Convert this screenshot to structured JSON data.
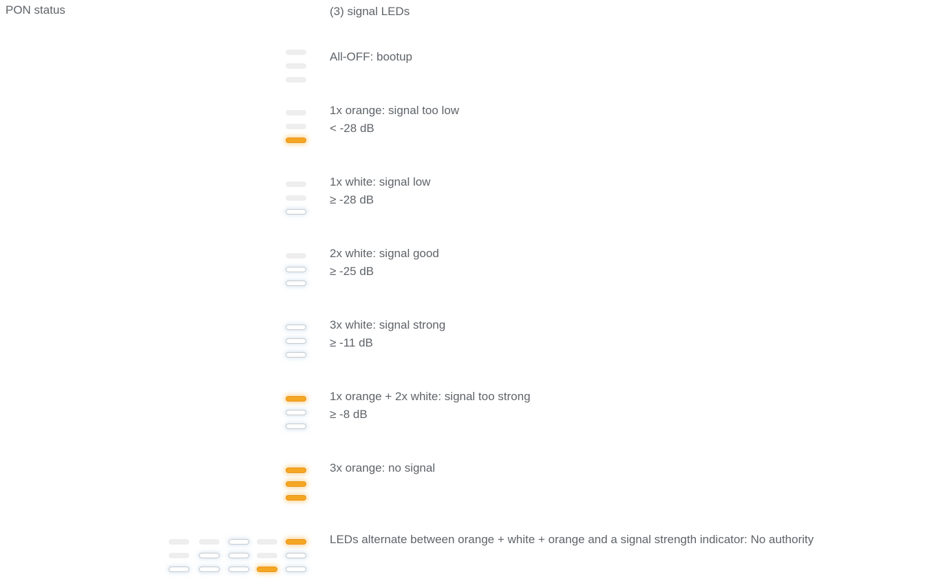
{
  "section_label": "PON status",
  "header": "(3) signal LEDs",
  "colors": {
    "off": "#eeeeee",
    "white": "#ffffff",
    "orange": "#f5a623"
  },
  "states": [
    {
      "leds": [
        "off",
        "off",
        "off"
      ],
      "lines": [
        "All-OFF: bootup"
      ]
    },
    {
      "leds": [
        "off",
        "off",
        "orange"
      ],
      "lines": [
        "1x orange: signal too low",
        "< -28 dB"
      ]
    },
    {
      "leds": [
        "off",
        "off",
        "white"
      ],
      "lines": [
        "1x white: signal low",
        "≥ -28 dB"
      ]
    },
    {
      "leds": [
        "off",
        "white",
        "white"
      ],
      "lines": [
        "2x white: signal good",
        "≥ -25 dB"
      ]
    },
    {
      "leds": [
        "white",
        "white",
        "white"
      ],
      "lines": [
        "3x white: signal strong",
        "≥ -11 dB"
      ]
    },
    {
      "leds": [
        "orange",
        "white",
        "white"
      ],
      "lines": [
        "1x orange + 2x white: signal too strong",
        "≥ -8 dB"
      ]
    },
    {
      "leds": [
        "orange",
        "orange",
        "orange"
      ],
      "lines": [
        "3x orange: no signal"
      ]
    },
    {
      "animation_frames": [
        [
          "off",
          "off",
          "white"
        ],
        [
          "off",
          "white",
          "white"
        ],
        [
          "white",
          "white",
          "white"
        ],
        [
          "off",
          "off",
          "orange"
        ],
        [
          "orange",
          "white",
          "white"
        ]
      ],
      "lines": [
        "LEDs alternate between orange + white + orange and a signal strength indicator: No authority"
      ]
    }
  ]
}
